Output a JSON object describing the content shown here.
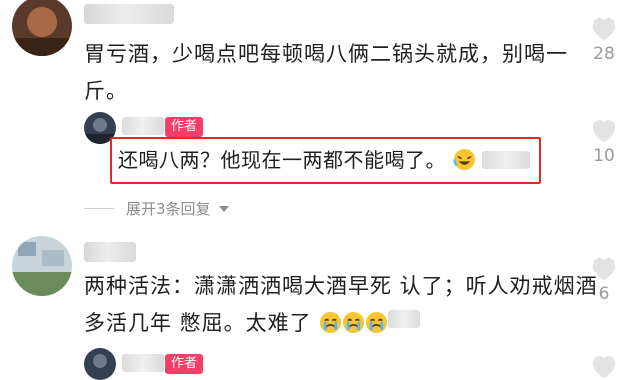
{
  "comments": [
    {
      "text_line1": "胃亏酒，少喝点吧每顿喝八俩二锅头就成，别喝一",
      "text_line2": "斤。",
      "likes": "28",
      "reply": {
        "badge": "作者",
        "text": "还喝八两？他现在一两都不能喝了。",
        "likes": "10"
      },
      "expand_label": "展开3条回复"
    },
    {
      "text_line1": "两种活法：潇潇洒洒喝大酒早死 认了；听人劝戒烟酒",
      "text_line2": "多活几年 憋屈。太难了",
      "likes": "6",
      "reply": {
        "badge": "作者"
      }
    }
  ],
  "icons": {
    "heart": "heart-outline-icon",
    "chevron": "chevron-down-icon",
    "emoji": "crying-laughing-emoji-icon"
  },
  "colors": {
    "badge": "#f53d68",
    "highlight": "#e02a2a",
    "heart": "#e3e3e3",
    "count": "#9a9a9a"
  }
}
